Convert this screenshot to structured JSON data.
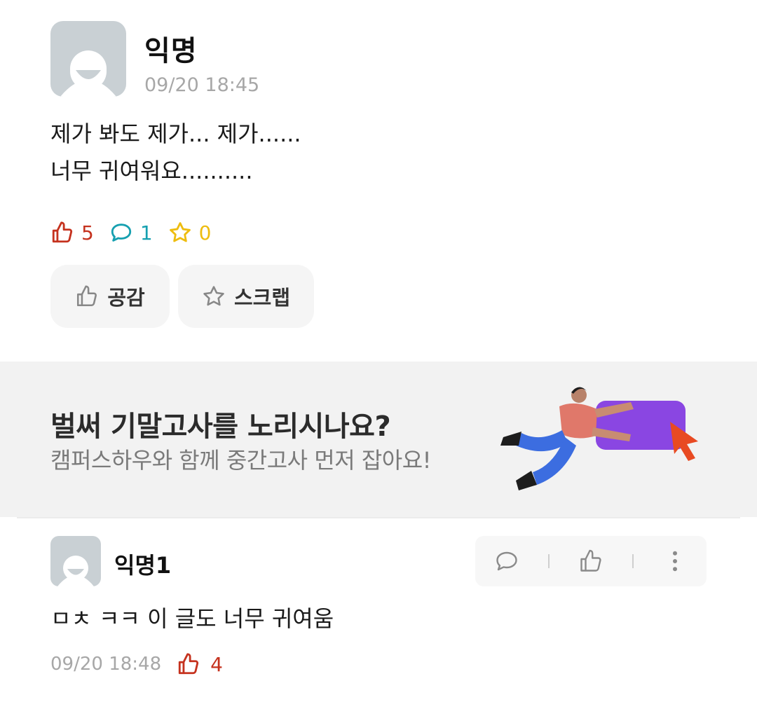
{
  "post": {
    "author": "익명",
    "time": "09/20 18:45",
    "body_line1": "제가 봐도 제가... 제가......",
    "body_line2": "너무 귀여워요..........",
    "likes": "5",
    "comments": "1",
    "scraps": "0",
    "like_button": "공감",
    "scrap_button": "스크랩"
  },
  "banner": {
    "title": "벌써 기말고사를 노리시나요?",
    "subtitle": "캠퍼스하우와 함께 중간고사 먼저 잡아요!"
  },
  "comment": {
    "author": "익명1",
    "body": "ㅁㅊ ㅋㅋ 이 글도 너무 귀여움",
    "time": "09/20 18:48",
    "likes": "4"
  },
  "colors": {
    "like": "#c5321e",
    "comment": "#16a0b0",
    "scrap": "#eebd10",
    "muted": "#a7a7a7",
    "avatar": "#c9d0d4"
  },
  "icons": [
    "thumbs-up-icon",
    "speech-bubble-icon",
    "star-icon",
    "more-vertical-icon"
  ]
}
